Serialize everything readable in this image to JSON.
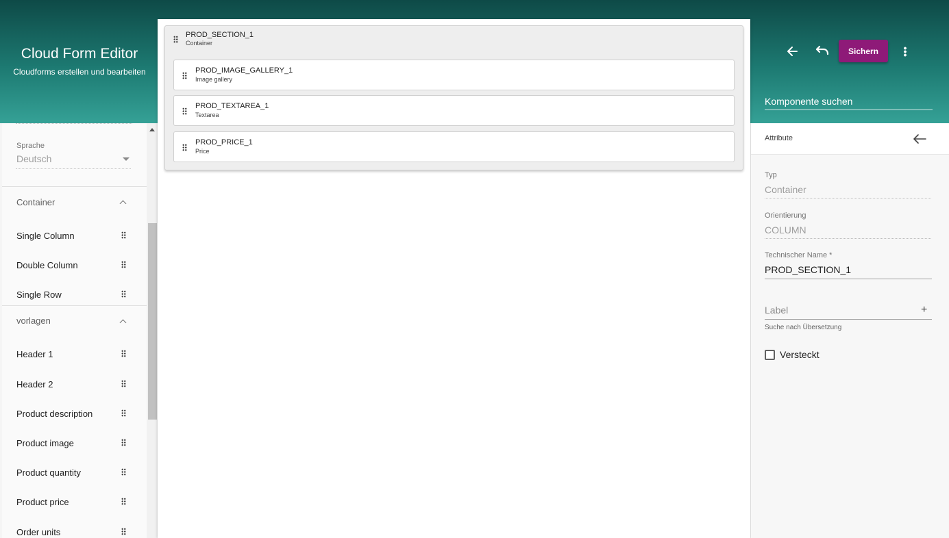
{
  "app": {
    "title": "Cloud Form Editor",
    "subtitle": "Cloudforms erstellen und bearbeiten"
  },
  "toolbar": {
    "back_icon": "arrow-left-icon",
    "undo_icon": "undo-icon",
    "save_label": "Sichern",
    "more_icon": "more-vertical-icon",
    "save_color": "#8e1a78"
  },
  "search": {
    "label": "Komponente suchen"
  },
  "sidebar": {
    "language": {
      "label": "Sprache",
      "value": "Deutsch"
    },
    "groups": [
      {
        "title": "Container",
        "items": [
          "Single Column",
          "Double Column",
          "Single Row"
        ]
      },
      {
        "title": "vorlagen",
        "items": [
          "Header 1",
          "Header 2",
          "Product description",
          "Product image",
          "Product quantity",
          "Product price",
          "Order units"
        ]
      }
    ]
  },
  "canvas": {
    "section": {
      "name": "PROD_SECTION_1",
      "type": "Container",
      "children": [
        {
          "name": "PROD_IMAGE_GALLERY_1",
          "type": "Image gallery"
        },
        {
          "name": "PROD_TEXTAREA_1",
          "type": "Textarea"
        },
        {
          "name": "PROD_PRICE_1",
          "type": "Price"
        }
      ]
    }
  },
  "attributes": {
    "title": "Attribute",
    "type": {
      "label": "Typ",
      "value": "Container"
    },
    "orientation": {
      "label": "Orientierung",
      "value": "COLUMN"
    },
    "technical_name": {
      "label": "Technischer Name *",
      "value": "PROD_SECTION_1"
    },
    "label_field": {
      "placeholder": "Label",
      "hint": "Suche nach Übersetzung"
    },
    "hidden": {
      "label": "Versteckt",
      "checked": false
    }
  },
  "colors": {
    "header_dark": "#0e4a47",
    "header_light": "#35a196",
    "accent": "#8e1a78"
  }
}
